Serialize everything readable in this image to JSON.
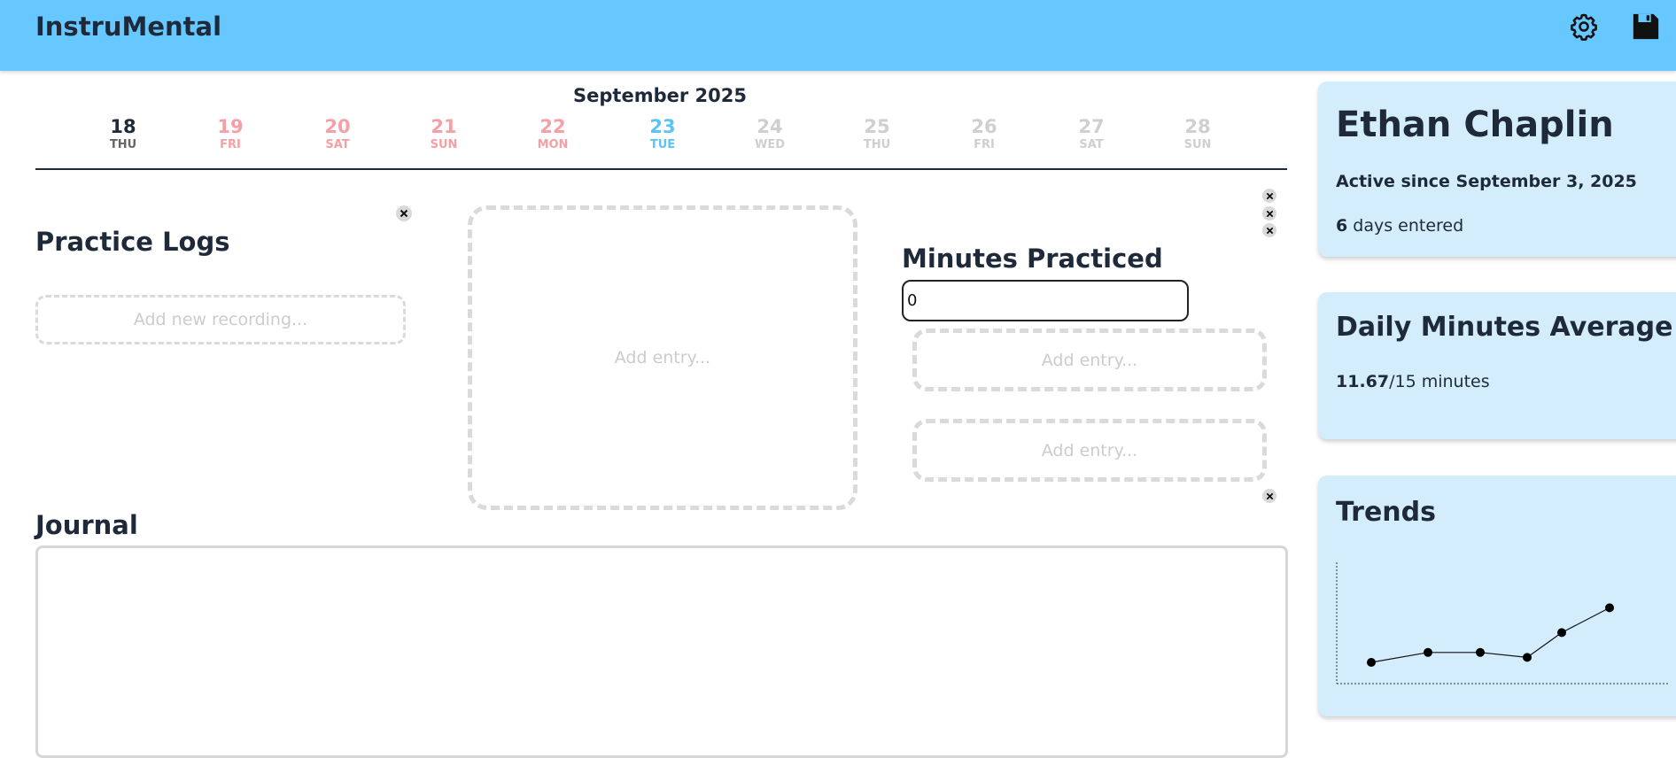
{
  "app": {
    "title": "InstruMental"
  },
  "header": {
    "settings_icon": "gear-icon",
    "save_icon": "floppy-disk-icon"
  },
  "calendar": {
    "month": "September 2025",
    "days": [
      {
        "num": "18",
        "name": "THU",
        "status": "selected",
        "color": "#1e2a3a"
      },
      {
        "num": "19",
        "name": "FRI",
        "status": "missed",
        "color": "#f4a0a6"
      },
      {
        "num": "20",
        "name": "SAT",
        "status": "missed",
        "color": "#f4a0a6"
      },
      {
        "num": "21",
        "name": "SUN",
        "status": "missed",
        "color": "#f4a0a6"
      },
      {
        "num": "22",
        "name": "MON",
        "status": "missed",
        "color": "#f4a0a6"
      },
      {
        "num": "23",
        "name": "TUE",
        "status": "today",
        "color": "#5cc4f5"
      },
      {
        "num": "24",
        "name": "WED",
        "status": "future",
        "color": "#cfcfcf"
      },
      {
        "num": "25",
        "name": "THU",
        "status": "future",
        "color": "#cfcfcf"
      },
      {
        "num": "26",
        "name": "FRI",
        "status": "future",
        "color": "#cfcfcf"
      },
      {
        "num": "27",
        "name": "SAT",
        "status": "future",
        "color": "#cfcfcf"
      },
      {
        "num": "28",
        "name": "SUN",
        "status": "future",
        "color": "#cfcfcf"
      }
    ]
  },
  "practice_logs": {
    "title": "Practice Logs",
    "add_recording": "Add new recording..."
  },
  "center_entry": {
    "placeholder": "Add entry..."
  },
  "minutes": {
    "title": "Minutes Practiced",
    "value": "0",
    "entries": [
      "Add entry...",
      "Add entry..."
    ]
  },
  "journal": {
    "title": "Journal",
    "value": ""
  },
  "profile": {
    "name": "Ethan Chaplin",
    "active_since": "Active since September 3, 2025",
    "days_count": "6",
    "days_label": " days entered"
  },
  "average": {
    "title": "Daily Minutes Average",
    "value": "11.67",
    "goal": "/15 minutes"
  },
  "trends": {
    "title": "Trends",
    "chart_data": {
      "type": "line",
      "series": [
        {
          "values": [
            0,
            1,
            1,
            0.5,
            3,
            5.5
          ]
        }
      ]
    }
  },
  "colors": {
    "header": "#66c8ff",
    "card": "#d4edfc",
    "text": "#1e2a3a"
  }
}
